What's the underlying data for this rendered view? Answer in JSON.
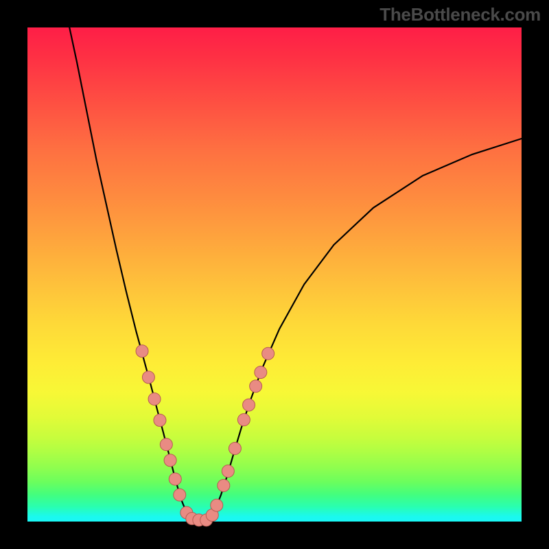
{
  "watermark": "TheBottleneck.com",
  "chart_data": {
    "type": "line",
    "title": "",
    "xlabel": "",
    "ylabel": "",
    "xlim": [
      0,
      100
    ],
    "ylim": [
      0,
      100
    ],
    "grid": false,
    "series": [
      {
        "name": "left-curve",
        "x": [
          8.5,
          10,
          12,
          14,
          16,
          18,
          20,
          22,
          23.5,
          25,
          26.3,
          27.5,
          28.8,
          30,
          31.1,
          32.2,
          33.0
        ],
        "y": [
          100,
          93,
          83,
          73,
          64,
          55,
          46.5,
          38.5,
          33,
          27.5,
          22.5,
          18,
          13,
          8.3,
          4.5,
          1.8,
          0.6
        ]
      },
      {
        "name": "flat-bottom",
        "x": [
          33.0,
          37.0
        ],
        "y": [
          0.4,
          0.4
        ]
      },
      {
        "name": "right-curve",
        "x": [
          37.0,
          38.0,
          39.2,
          40.5,
          41.8,
          43.3,
          45.0,
          47.5,
          51.0,
          56.0,
          62.0,
          70.0,
          80.0,
          90.0,
          100.0
        ],
        "y": [
          0.6,
          2.4,
          5.5,
          9.5,
          14.0,
          19.0,
          24.2,
          31.0,
          39.0,
          48.0,
          56.0,
          63.5,
          70.0,
          74.3,
          77.5
        ]
      }
    ],
    "markers": [
      {
        "series": "dots",
        "x": 23.2,
        "y": 34.5
      },
      {
        "series": "dots",
        "x": 24.5,
        "y": 29.2
      },
      {
        "series": "dots",
        "x": 25.7,
        "y": 24.8
      },
      {
        "series": "dots",
        "x": 26.8,
        "y": 20.5
      },
      {
        "series": "dots",
        "x": 28.1,
        "y": 15.6
      },
      {
        "series": "dots",
        "x": 28.9,
        "y": 12.4
      },
      {
        "series": "dots",
        "x": 29.9,
        "y": 8.6
      },
      {
        "series": "dots",
        "x": 30.8,
        "y": 5.4
      },
      {
        "series": "dots",
        "x": 32.2,
        "y": 1.8
      },
      {
        "series": "dots",
        "x": 33.3,
        "y": 0.6
      },
      {
        "series": "dots",
        "x": 34.7,
        "y": 0.3
      },
      {
        "series": "dots",
        "x": 36.2,
        "y": 0.3
      },
      {
        "series": "dots",
        "x": 37.4,
        "y": 1.3
      },
      {
        "series": "dots",
        "x": 38.3,
        "y": 3.3
      },
      {
        "series": "dots",
        "x": 39.7,
        "y": 7.3
      },
      {
        "series": "dots",
        "x": 40.6,
        "y": 10.2
      },
      {
        "series": "dots",
        "x": 42.0,
        "y": 14.8
      },
      {
        "series": "dots",
        "x": 43.8,
        "y": 20.6
      },
      {
        "series": "dots",
        "x": 44.8,
        "y": 23.6
      },
      {
        "series": "dots",
        "x": 46.2,
        "y": 27.4
      },
      {
        "series": "dots",
        "x": 47.2,
        "y": 30.2
      },
      {
        "series": "dots",
        "x": 48.7,
        "y": 34.0
      }
    ],
    "colors": {
      "curve": "#000000",
      "marker_fill": "#e98b83",
      "marker_stroke": "#b55b52",
      "gradient_top": "#fe1e47",
      "gradient_bottom": "#1af7f6"
    }
  }
}
